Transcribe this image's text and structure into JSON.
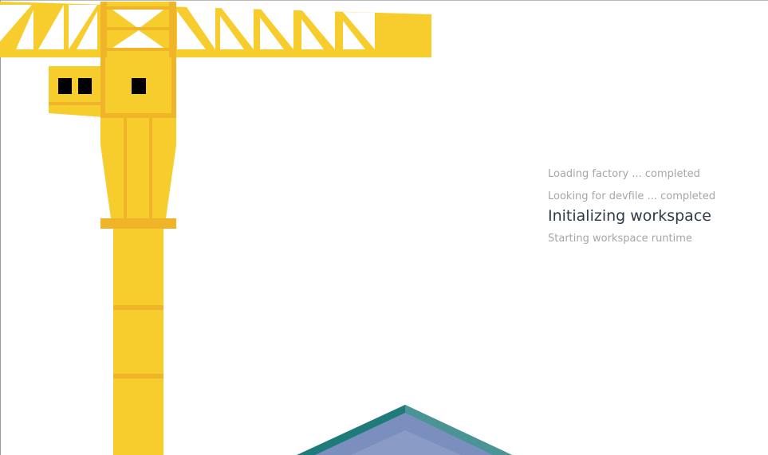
{
  "loader": {
    "steps": [
      {
        "label": "Loading factory ... completed",
        "state": "completed"
      },
      {
        "label": "Looking for devfile ... completed",
        "state": "completed"
      },
      {
        "label": "Initializing workspace",
        "state": "active"
      },
      {
        "label": "Starting workspace runtime",
        "state": "pending"
      }
    ]
  },
  "colors": {
    "crane_yellow": "#f7cd2d",
    "crane_orange": "#f0b429",
    "crane_window": "#000000",
    "platform_teal": "#1f7a7a",
    "platform_blue": "#7a8fbd",
    "text_muted": "#a6a6a6",
    "text_active": "#2e3a4a"
  },
  "illustration": {
    "icon": "construction-crane-icon",
    "platform_icon": "isometric-platform-icon"
  }
}
